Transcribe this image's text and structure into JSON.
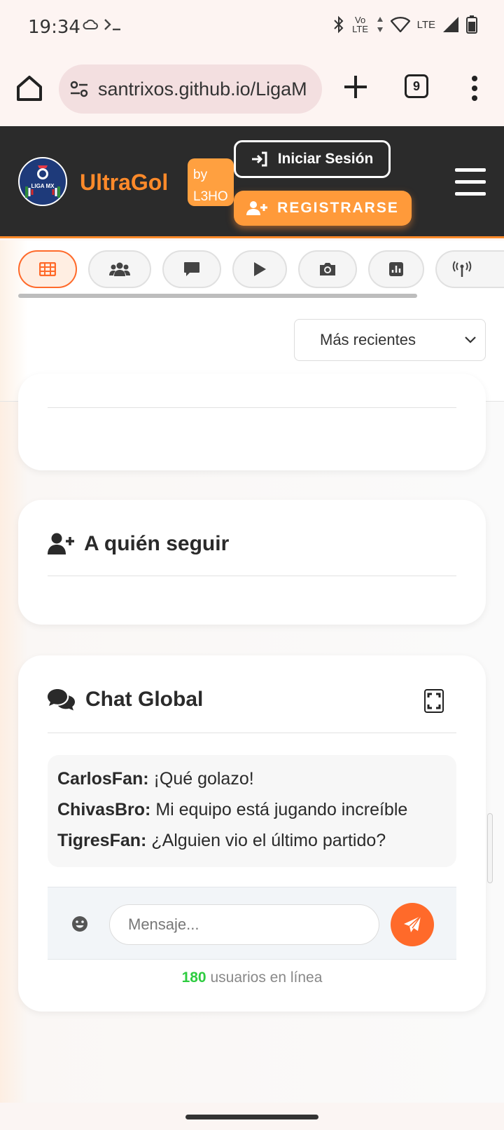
{
  "status_bar": {
    "time": "19:34",
    "icons": [
      "cloud-icon",
      "terminal-icon",
      "bluetooth-icon",
      "volte-icon",
      "wifi-icon",
      "lte-icon",
      "signal-icon",
      "battery-icon"
    ],
    "volte_label": "Vo LTE",
    "lte_label": "LTE"
  },
  "browser": {
    "url": "santrixos.github.io/LigaM",
    "tab_count": "9"
  },
  "header": {
    "brand": "UltraGol",
    "by_label": "by",
    "author": "L3HO",
    "login_label": "Iniciar Sesión",
    "register_label": "REGISTRARSE",
    "logo_text": "LIGA MX",
    "accent_color": "#ff8a2a"
  },
  "icon_tabs": [
    {
      "icon": "grid-icon",
      "active": true
    },
    {
      "icon": "users-icon",
      "active": false
    },
    {
      "icon": "comment-icon",
      "active": false
    },
    {
      "icon": "play-icon",
      "active": false
    },
    {
      "icon": "camera-icon",
      "active": false
    },
    {
      "icon": "chart-icon",
      "active": false
    },
    {
      "icon": "broadcast-icon",
      "active": false
    }
  ],
  "sort": {
    "selected": "Más recientes"
  },
  "follow_card": {
    "title": "A quién seguir"
  },
  "chat": {
    "title": "Chat Global",
    "messages": [
      {
        "user": "CarlosFan:",
        "text": "¡Qué golazo!"
      },
      {
        "user": "ChivasBro:",
        "text": "Mi equipo está jugando increíble"
      },
      {
        "user": "TigresFan:",
        "text": "¿Alguien vio el último partido?"
      }
    ],
    "input_placeholder": "Mensaje...",
    "online_count": "180",
    "online_label": "usuarios en línea",
    "send_color": "#ff6a2a",
    "online_color": "#2ecc40"
  }
}
